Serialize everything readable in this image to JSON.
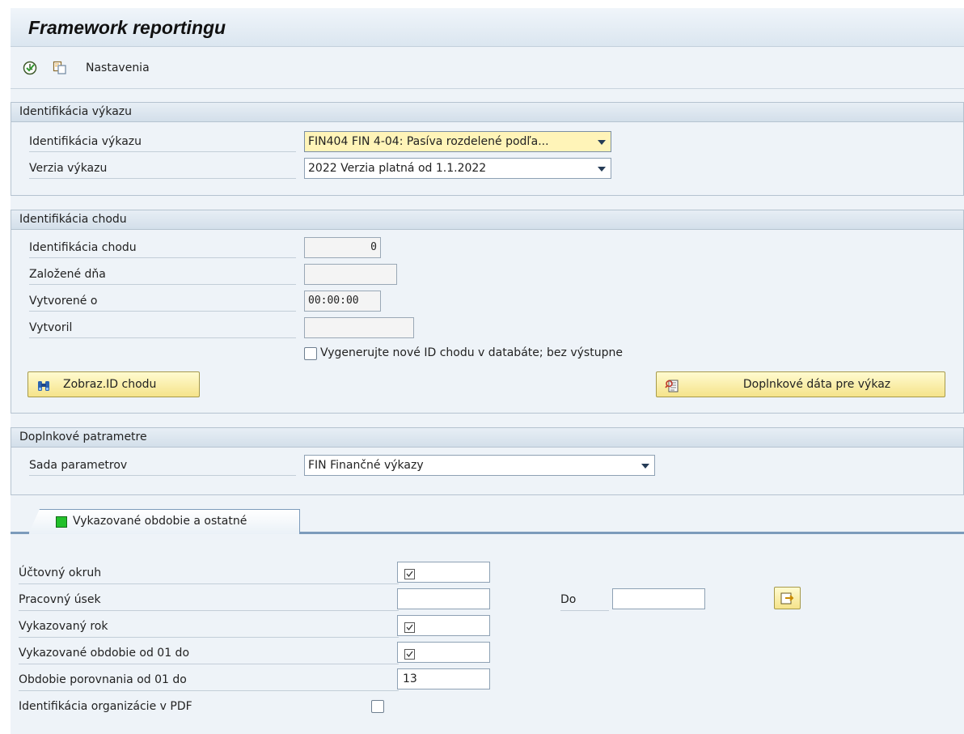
{
  "app": {
    "title": "Framework reportingu"
  },
  "toolbar": {
    "execute_icon": "execute-clock-icon",
    "variant_icon": "get-variant-icon",
    "settings_label": "Nastavenia"
  },
  "report_group": {
    "header": "Identifikácia výkazu",
    "report_id_label": "Identifikácia výkazu",
    "report_id_value": "FIN404 FIN 4-04: Pasíva rozdelené podľa...",
    "version_label": "Verzia výkazu",
    "version_value": "2022 Verzia platná od 1.1.2022"
  },
  "run_group": {
    "header": "Identifikácia chodu",
    "run_id_label": "Identifikácia chodu",
    "run_id_value": "0",
    "created_on_label": "Založené dňa",
    "created_on_value": "",
    "created_at_label": "Vytvorené o",
    "created_at_value": "00:00:00",
    "created_by_label": "Vytvoril",
    "created_by_value": "",
    "generate_new_id_label": "Vygenerujte nové ID chodu v databáte; bez výstupne",
    "generate_new_id_checked": false,
    "show_run_id_button": "Zobraz.ID chodu",
    "additional_data_button": "Doplnkové dáta pre výkaz"
  },
  "params_group": {
    "header": "Doplnkové patrametre",
    "param_set_label": "Sada parametrov",
    "param_set_value": "FIN Finančné výkazy"
  },
  "tab": {
    "label": "Vykazované obdobie a ostatné",
    "status_color": "#22c02a"
  },
  "period_fields": {
    "company_code_label": "Účtovný okruh",
    "company_code_required": true,
    "segment_label": "Pracovný úsek",
    "segment_value": "",
    "to_label": "Do",
    "to_value": "",
    "year_label": "Vykazovaný rok",
    "year_required": true,
    "period_label": "Vykazované obdobie od 01 do",
    "period_required": true,
    "compare_label": "Obdobie porovnania od 01 do",
    "compare_value": "13",
    "org_pdf_label": "Identifikácia organizácie v PDF",
    "org_pdf_checked": false
  },
  "colors": {
    "title_bg": "#dbe6f0",
    "panel_bg": "#eef3f8",
    "button_yellow": "#f5e38a",
    "focus_field": "#fff4b8",
    "tab_border": "#7c9bbb"
  }
}
